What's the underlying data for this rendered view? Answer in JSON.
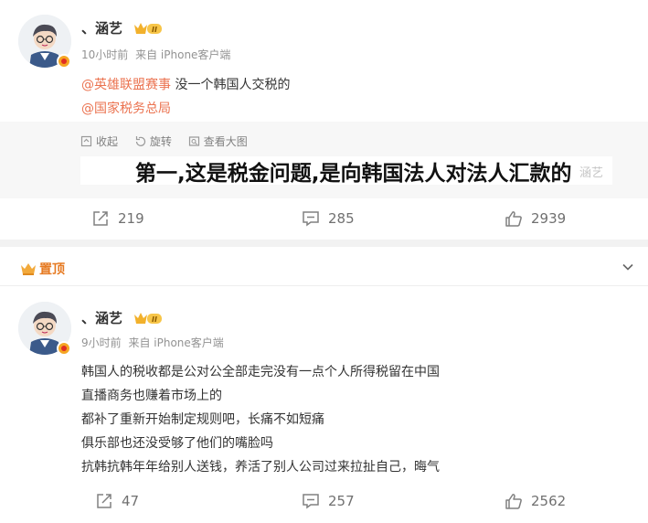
{
  "post1": {
    "username": "、涵艺",
    "time": "10小时前",
    "source": "来自 iPhone客户端",
    "mention1": "@英雄联盟赛事",
    "text1": " 没一个韩国人交税的",
    "mention2": "@国家税务总局",
    "tools": {
      "collect": "收起",
      "rotate": "旋转",
      "view_large": "查看大图"
    },
    "image_caption": "第一,这是税金问题,是向韩国法人对法人汇款的",
    "watermark": "涵艺",
    "reposts": "219",
    "comments": "285",
    "likes": "2939"
  },
  "pinned_label": "置顶",
  "post2": {
    "username": "、涵艺",
    "time": "9小时前",
    "source": "来自 iPhone客户端",
    "lines": [
      "韩国人的税收都是公对公全部走完没有一点个人所得税留在中国",
      "直播商务也赚着市场上的",
      "都补了重新开始制定规则吧，长痛不如短痛",
      "俱乐部也还没受够了他们的嘴脸吗",
      "抗韩抗韩年年给别人送钱，养活了别人公司过来拉扯自己，晦气"
    ],
    "reposts": "47",
    "comments": "257",
    "likes": "2562"
  },
  "colors": {
    "mention": "#eb7350",
    "pinned": "#e67a22",
    "muted": "#939393"
  },
  "icons": [
    "repost-icon",
    "comment-icon",
    "like-icon",
    "collapse-icon",
    "rotate-icon",
    "view-large-icon",
    "crown-icon",
    "chevron-down-icon",
    "vip-badge-icon",
    "verified-badge-icon"
  ]
}
